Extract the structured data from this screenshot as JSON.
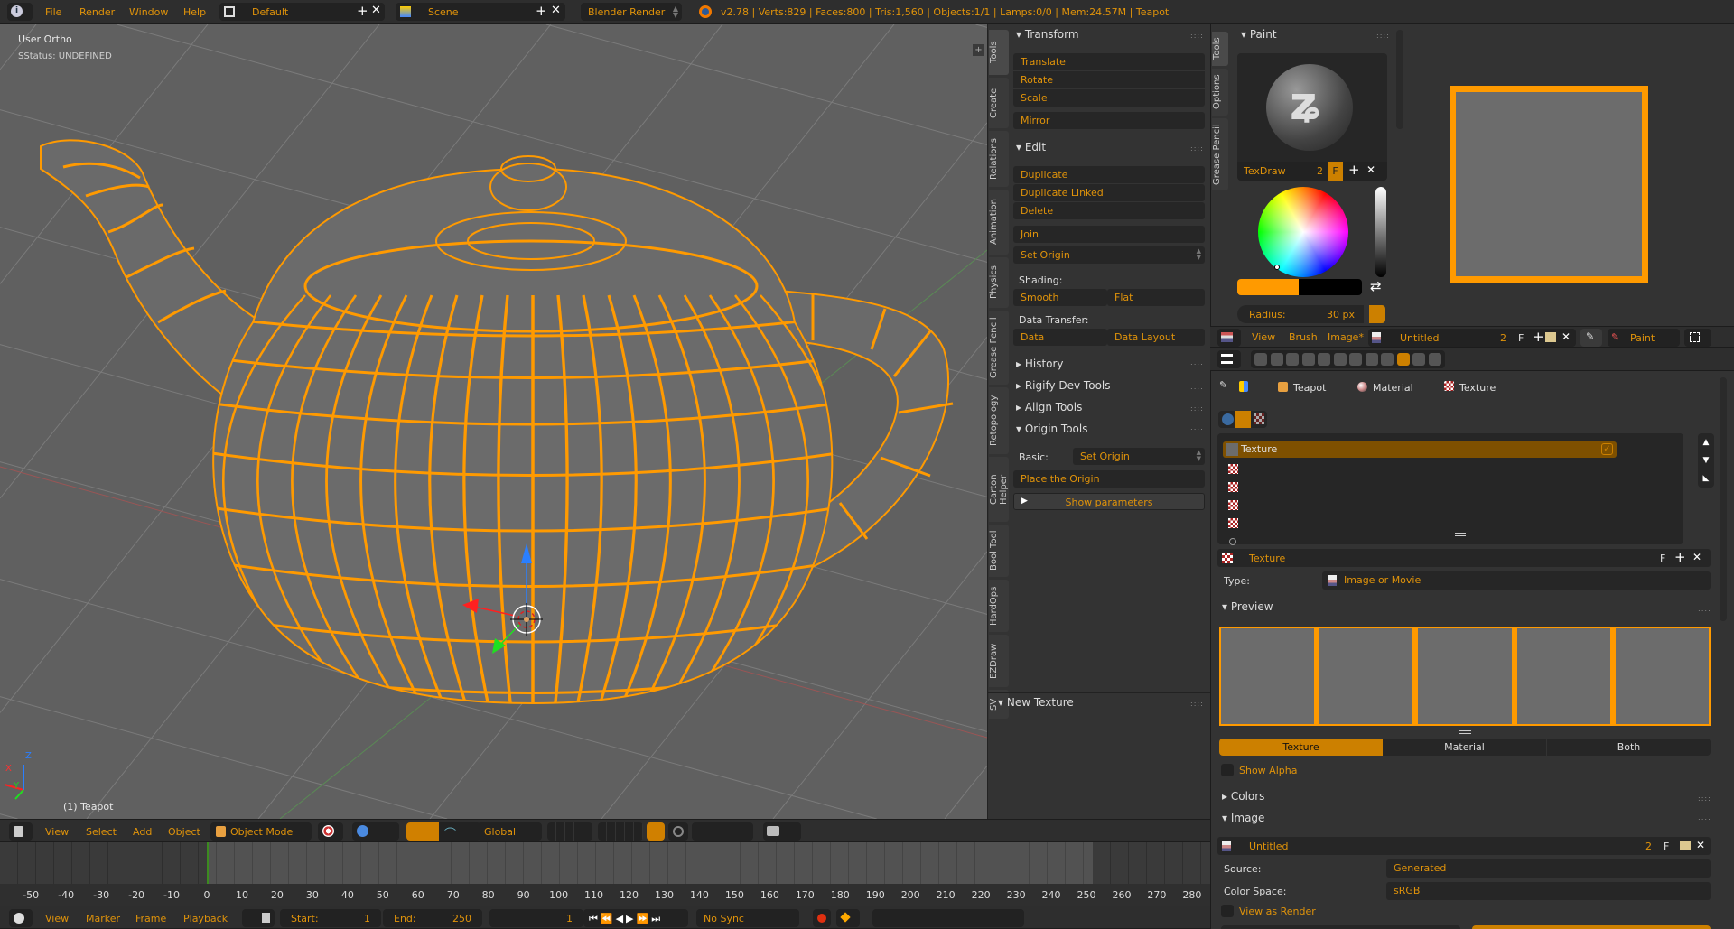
{
  "topbar": {
    "menus": [
      "File",
      "Render",
      "Window",
      "Help"
    ],
    "layout": "Default",
    "scene": "Scene",
    "engine": "Blender Render",
    "stats": "v2.78 | Verts:829 | Faces:800 | Tris:1,560 | Objects:1/1 | Lamps:0/0 | Mem:24.57M | Teapot",
    "icons": [
      "info-icon",
      "layout-icon",
      "scene-icon",
      "blender-logo-icon"
    ]
  },
  "viewport": {
    "view_name": "User Ortho",
    "status": "SStatus: UNDEFINED",
    "object_label": "(1) Teapot",
    "axis_labels": [
      "X",
      "Y",
      "Z"
    ],
    "wire_color": "#ff9a00",
    "background": "#606060"
  },
  "viewport_header": {
    "menus": [
      "View",
      "Select",
      "Add",
      "Object"
    ],
    "mode": "Object Mode",
    "orientation": "Global"
  },
  "toolshelf": {
    "tabs": [
      "Tools",
      "Create",
      "Relations",
      "Animation",
      "Physics",
      "Grease Pencil",
      "Retopology",
      "Carton Helper",
      "Bool Tool",
      "HardOps",
      "EZDraw",
      "SV"
    ],
    "transform": {
      "title": "Transform",
      "buttons": [
        "Translate",
        "Rotate",
        "Scale",
        "Mirror"
      ]
    },
    "edit": {
      "title": "Edit",
      "buttons": [
        "Duplicate",
        "Duplicate Linked",
        "Delete",
        "Join",
        "Set Origin"
      ],
      "shading_label": "Shading:",
      "smooth": "Smooth",
      "flat": "Flat",
      "data_transfer_label": "Data Transfer:",
      "data": "Data",
      "data_layout": "Data Layout"
    },
    "collapsed": [
      "History",
      "Rigify Dev Tools",
      "Align Tools"
    ],
    "origin": {
      "title": "Origin Tools",
      "basic_label": "Basic:",
      "basic_value": "Set Origin",
      "place": "Place the Origin",
      "show_params": "Show parameters"
    },
    "new_texture": "New Texture"
  },
  "timeline": {
    "ticks": [
      "-50",
      "-40",
      "-30",
      "-20",
      "-10",
      "0",
      "10",
      "20",
      "30",
      "40",
      "50",
      "60",
      "70",
      "80",
      "90",
      "100",
      "110",
      "120",
      "130",
      "140",
      "150",
      "160",
      "170",
      "180",
      "190",
      "200",
      "210",
      "220",
      "230",
      "240",
      "250",
      "260",
      "270",
      "280"
    ],
    "menus": [
      "View",
      "Marker",
      "Frame",
      "Playback"
    ],
    "start_label": "Start:",
    "start": "1",
    "end_label": "End:",
    "end": "250",
    "current": "1",
    "sync": "No Sync"
  },
  "image_editor": {
    "tabs": [
      "Tools",
      "Options",
      "Grease Pencil"
    ],
    "panel_title": "Paint",
    "brush": "TexDraw",
    "brush_users": "2",
    "fake_user": "F",
    "radius_label": "Radius:",
    "radius_value": "30 px",
    "menus": [
      "View",
      "Brush",
      "Image*"
    ],
    "image_name": "Untitled",
    "image_users": "2",
    "image_fake": "F",
    "mode": "Paint",
    "color": "#ff9a00"
  },
  "properties": {
    "breadcrumb": [
      "Teapot",
      "Material",
      "Texture"
    ],
    "slot_name": "Texture",
    "tex_name": "Texture",
    "tex_fake": "F",
    "type_label": "Type:",
    "type_value": "Image or Movie",
    "preview_title": "Preview",
    "preview_tabs": [
      "Texture",
      "Material",
      "Both"
    ],
    "show_alpha": "Show Alpha",
    "colors_title": "Colors",
    "image_title": "Image",
    "image_name": "Untitled",
    "image_users": "2",
    "image_fake": "F",
    "source_label": "Source:",
    "source_value": "Generated",
    "colorspace_label": "Color Space:",
    "colorspace_value": "sRGB",
    "view_as_render": "View as Render"
  }
}
